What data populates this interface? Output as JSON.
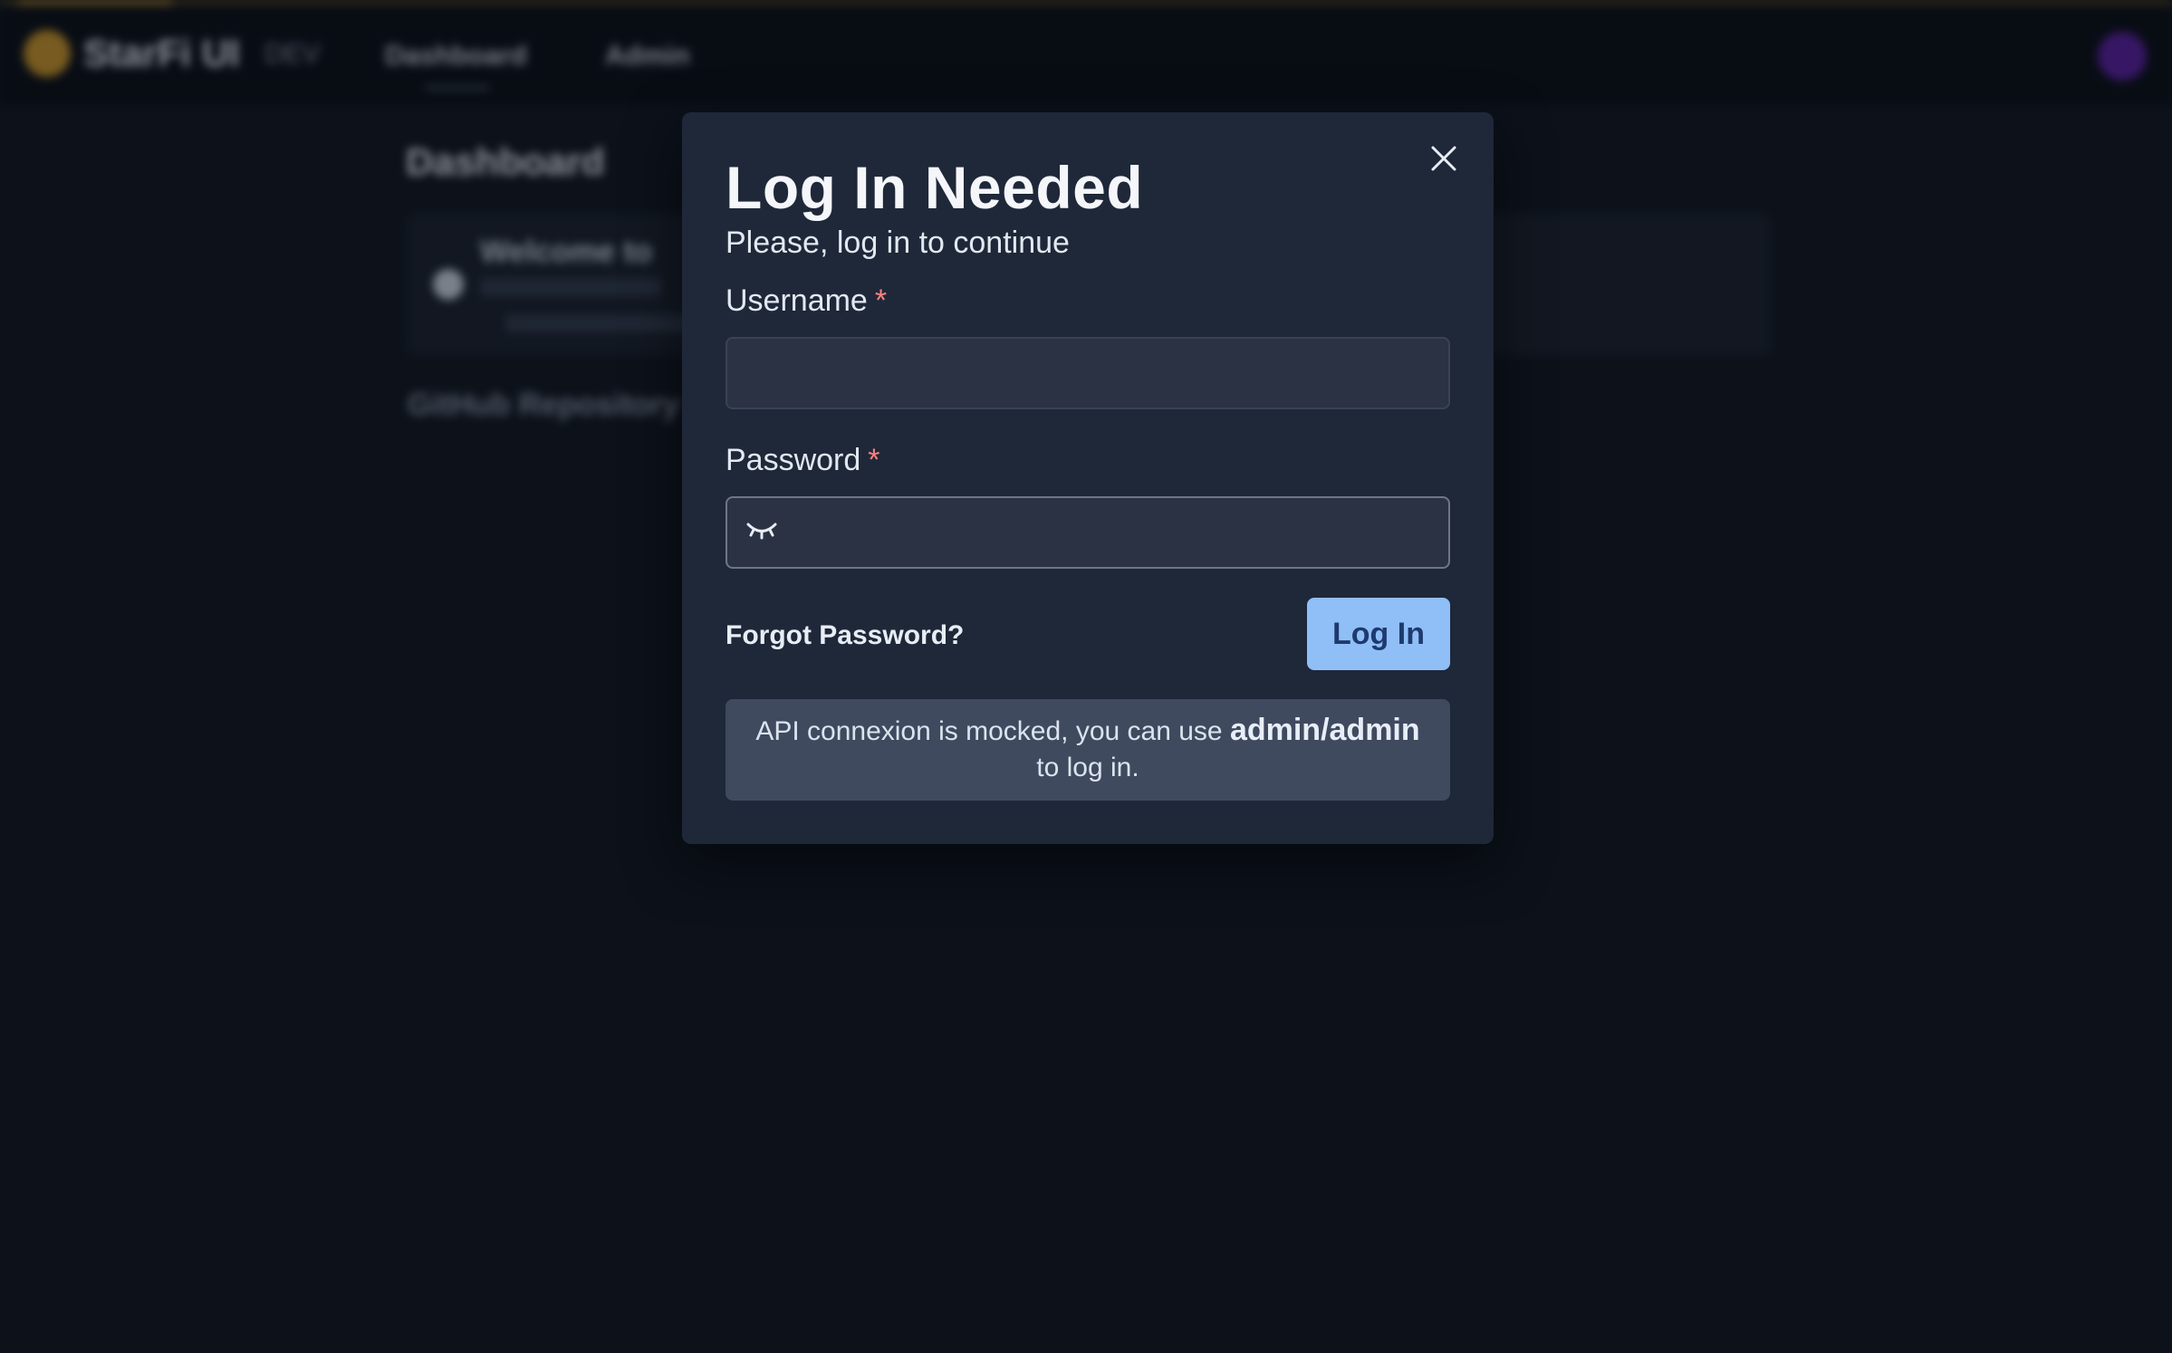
{
  "background": {
    "brand": {
      "name": "StarFi UI",
      "tag": "DEV"
    },
    "nav": [
      {
        "label": "Dashboard"
      },
      {
        "label": "Admin"
      }
    ],
    "dashboard": {
      "title": "Dashboard",
      "welcome_title": "Welcome to",
      "repo_link": "GitHub Repository"
    }
  },
  "modal": {
    "title": "Log In Needed",
    "subtitle": "Please, log in to continue",
    "username": {
      "label": "Username",
      "required_mark": "*",
      "value": "",
      "placeholder": ""
    },
    "password": {
      "label": "Password",
      "required_mark": "*",
      "value": "",
      "placeholder": ""
    },
    "forgot_password": "Forgot Password?",
    "login_button": "Log In",
    "info": {
      "text_before": "API connexion is mocked, you can use ",
      "credentials": "admin/admin",
      "text_after": " to log in."
    }
  },
  "icons": {
    "close": "close-icon",
    "eye": "eye-closed-icon"
  },
  "colors": {
    "background": "#111620",
    "modal_bg": "#1f2839",
    "input_bg": "#2b3243",
    "primary_button": "#90bff7",
    "primary_button_text": "#1e3a6e",
    "required": "#fc8181",
    "info_bg": "#3f4a5f",
    "progress": "#d69e2e",
    "avatar": "#5a1fa0"
  }
}
